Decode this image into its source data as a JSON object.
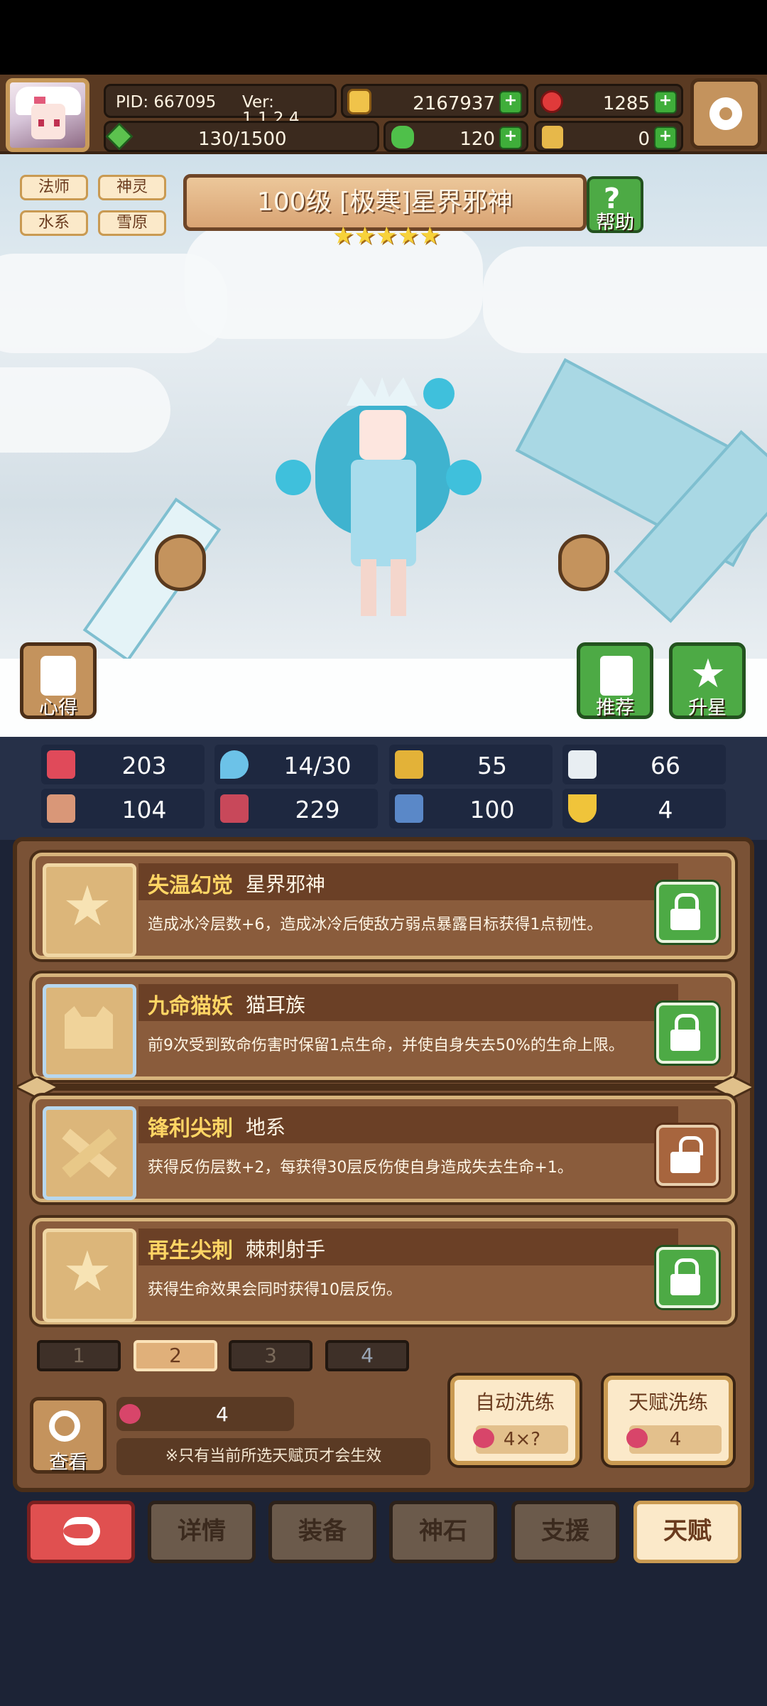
{
  "header": {
    "pid": "PID: 667095",
    "version": "Ver: 1.1.2.4",
    "gold": "2167937",
    "gems": "1285",
    "energy": "130/1500",
    "clover": "120",
    "token": "0"
  },
  "hero": {
    "tags": [
      "法师",
      "神灵",
      "水系",
      "雪原"
    ],
    "title": "100级 [极寒]星界邪神",
    "stars": 5,
    "help_label": "帮助",
    "insight_label": "心得",
    "recommend_label": "推荐",
    "upstar_label": "升星"
  },
  "stats": [
    {
      "icon": "heart-icon",
      "value": "203"
    },
    {
      "icon": "drop-icon",
      "value": "14/30"
    },
    {
      "icon": "shield-icon",
      "value": "55"
    },
    {
      "icon": "wing-icon",
      "value": "66"
    },
    {
      "icon": "fist-icon",
      "value": "104"
    },
    {
      "icon": "book-icon",
      "value": "229"
    },
    {
      "icon": "boot-icon",
      "value": "100"
    },
    {
      "icon": "magnet-icon",
      "value": "4"
    }
  ],
  "talents": [
    {
      "name": "失温幻觉",
      "race": "星界邪神",
      "desc": "造成冰冷层数+6，造成冰冷后使敌方弱点暴露目标获得1点韧性。",
      "icon": "star-icon",
      "lock": "locked"
    },
    {
      "name": "九命猫妖",
      "race": "猫耳族",
      "desc": "前9次受到致命伤害时保留1点生命，并使自身失去50%的生命上限。",
      "icon": "cat-icon",
      "lock": "locked"
    },
    {
      "name": "锋利尖刺",
      "race": "地系",
      "desc": "获得反伤层数+2，每获得30层反伤使自身造成失去生命+1。",
      "icon": "spikes-icon",
      "lock": "unlocked"
    },
    {
      "name": "再生尖刺",
      "race": "棘刺射手",
      "desc": "获得生命效果会同时获得10层反伤。",
      "icon": "star-icon",
      "lock": "locked"
    }
  ],
  "pages": [
    "1",
    "2",
    "3",
    "4"
  ],
  "active_page": "2",
  "footer_panel": {
    "view_label": "查看",
    "fruit_count": "4",
    "note": "※只有当前所选天赋页才会生效",
    "auto_wash_title": "自动洗练",
    "auto_wash_cost": "4×?",
    "talent_wash_title": "天赋洗练",
    "talent_wash_cost": "4"
  },
  "nav": [
    "详情",
    "装备",
    "神石",
    "支援",
    "天赋"
  ],
  "active_nav": "天赋",
  "colors": {
    "accent_gold": "#ffd564",
    "panel_brown": "#7a5236",
    "lock_green": "#4daa45"
  }
}
